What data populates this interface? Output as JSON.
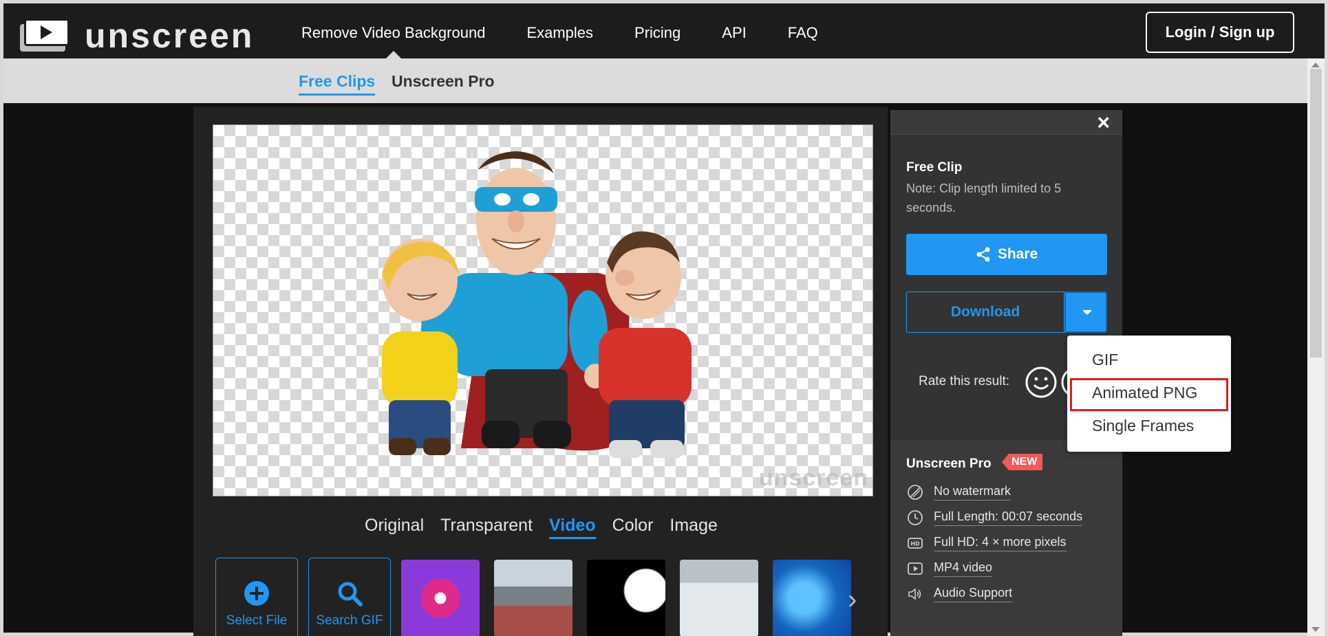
{
  "header": {
    "logo_text": "unscreen",
    "nav": [
      {
        "label": "Remove Video Background",
        "active": true
      },
      {
        "label": "Examples"
      },
      {
        "label": "Pricing"
      },
      {
        "label": "API"
      },
      {
        "label": "FAQ"
      }
    ],
    "login_label": "Login / Sign up"
  },
  "subnav": {
    "items": [
      {
        "label": "Free Clips",
        "active": true
      },
      {
        "label": "Unscreen Pro"
      }
    ]
  },
  "preview": {
    "watermark": "unscreen",
    "view_tabs": [
      "Original",
      "Transparent",
      "Video",
      "Color",
      "Image"
    ],
    "active_tab": "Video"
  },
  "strip": {
    "select_file": "Select File",
    "search_gif": "Search GIF"
  },
  "side": {
    "free_title": "Free Clip",
    "free_note": "Note: Clip length limited to 5 seconds.",
    "share_label": "Share",
    "download_label": "Download",
    "rate_label": "Rate this result:",
    "pro_title": "Unscreen Pro",
    "new_badge": "NEW",
    "features": [
      {
        "icon": "no-watermark-icon",
        "label": "No watermark"
      },
      {
        "icon": "clock-icon",
        "label": "Full Length: 00:07 seconds"
      },
      {
        "icon": "hd-icon",
        "label": "Full HD: 4 × more pixels"
      },
      {
        "icon": "play-icon",
        "label": "MP4 video"
      },
      {
        "icon": "speaker-icon",
        "label": "Audio Support"
      }
    ]
  },
  "dropdown": {
    "options": [
      "GIF",
      "Animated PNG",
      "Single Frames"
    ],
    "highlighted": "Animated PNG"
  },
  "colors": {
    "accent": "#2196f3",
    "highlight": "#e01b1b",
    "badge": "#f05a5a"
  }
}
